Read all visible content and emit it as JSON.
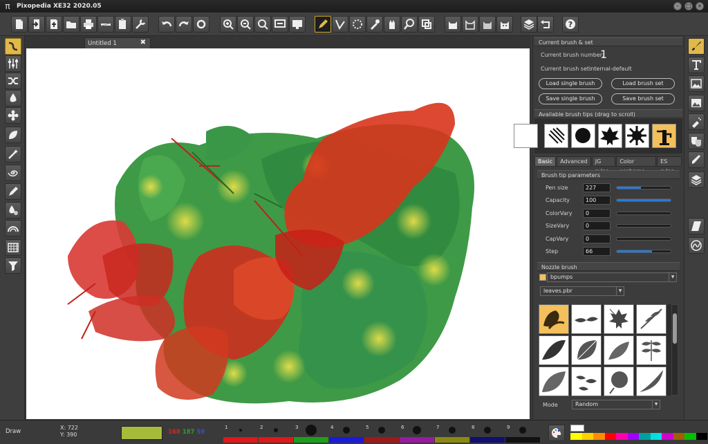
{
  "window": {
    "title": "Pixopedia XE32 2020.05",
    "app_icon": "π"
  },
  "document_tab": {
    "label": "Untitled 1",
    "close": "✖"
  },
  "panel": {
    "current_brush": {
      "header": "Current brush & set",
      "number_label": "Current brush number:",
      "number_value": "1",
      "set_label": "Current brush set:",
      "set_value": "internal-default",
      "buttons": [
        "Load single brush",
        "Load brush set",
        "Save single brush",
        "Save brush set"
      ]
    },
    "available_tips": {
      "header": "Available brush tips (drag to scroll)"
    },
    "tabs": [
      "Basic",
      "Advanced",
      "JG rules",
      "Color sceheme",
      "ES rules"
    ],
    "active_tab": "Basic",
    "params": {
      "header": "Brush tip parameters",
      "rows": [
        {
          "label": "Pen size",
          "value": "227",
          "level": 0.45
        },
        {
          "label": "Capacity",
          "value": "100",
          "level": 1.0
        },
        {
          "label": "ColorVary",
          "value": "0",
          "level": 0.0
        },
        {
          "label": "SizeVary",
          "value": "0",
          "level": 0.0
        },
        {
          "label": "CapVary",
          "value": "0",
          "level": 0.0
        },
        {
          "label": "Step",
          "value": "66",
          "level": 0.66
        }
      ]
    },
    "nozzle": {
      "header": "Nozzle brush",
      "set_value": "bpumps",
      "file_value": "leaves.pbr",
      "mode_label": "Mode",
      "mode_value": "Random"
    }
  },
  "status": {
    "mode": "Draw",
    "x": "X: 722",
    "y": "Y: 390",
    "color_hex": "#a7bb3b",
    "r": "168",
    "g": "187",
    "b": "59"
  },
  "presets": {
    "numbers": [
      "1",
      "2",
      "3",
      "4",
      "5",
      "6",
      "7",
      "8",
      "9"
    ],
    "colors": [
      "#e01818",
      "#e01818",
      "#1aa01a",
      "#1a1ae0",
      "#a01818",
      "#9a1aa0",
      "#8a8a10",
      "#101070",
      "#111111"
    ]
  },
  "palette": [
    "#ffff00",
    "#ffd000",
    "#ff8c00",
    "#ff0000",
    "#ff00aa",
    "#a000ff",
    "#00a0a0",
    "#00e0e0",
    "#d000d0",
    "#a06000",
    "#00c000",
    "#000000"
  ]
}
